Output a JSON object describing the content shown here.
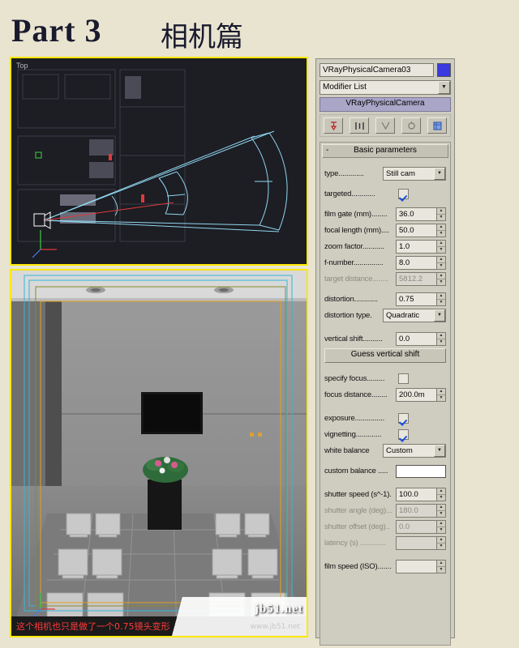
{
  "title": {
    "part": "Part 3",
    "chinese": "相机篇"
  },
  "viewport_top": {
    "label": "Top"
  },
  "viewport_bottom": {
    "caption": "这个相机也只是做了一个0.75镜头变形"
  },
  "panel": {
    "object_name": "VRayPhysicalCamera03",
    "object_color": "#3a3ae0",
    "modifier_list": "Modifier List",
    "modifier_stack_entry": "VRayPhysicalCamera",
    "stack_tools": [
      {
        "name": "pin-stack-icon"
      },
      {
        "name": "show-end-result-icon"
      },
      {
        "name": "make-unique-icon"
      },
      {
        "name": "remove-modifier-icon"
      },
      {
        "name": "configure-sets-icon"
      }
    ],
    "rollout": {
      "title": "Basic parameters",
      "collapse_sign": "-",
      "rows": [
        {
          "label": "type.............",
          "kind": "combo",
          "value": "Still cam"
        },
        {
          "label": "targeted............",
          "kind": "check",
          "value": true
        },
        {
          "label": "film gate (mm)........",
          "kind": "spin",
          "value": "36.0"
        },
        {
          "label": "focal length (mm)....",
          "kind": "spin",
          "value": "50.0"
        },
        {
          "label": "zoom factor...........",
          "kind": "spin",
          "value": "1.0"
        },
        {
          "label": "f-number...............",
          "kind": "spin",
          "value": "8.0"
        },
        {
          "label": "target distance........",
          "kind": "spin",
          "value": "5812.2",
          "disabled": true
        },
        {
          "label": "distortion............",
          "kind": "spin",
          "value": "0.75"
        },
        {
          "label": "distortion type.",
          "kind": "combo",
          "value": "Quadratic"
        },
        {
          "label": "vertical shift..........",
          "kind": "spin",
          "value": "0.0"
        },
        {
          "label": "Guess vertical shift",
          "kind": "button"
        },
        {
          "label": "specify focus.........",
          "kind": "check",
          "value": false
        },
        {
          "label": "focus distance........",
          "kind": "spin",
          "value": "200.0m"
        },
        {
          "label": "exposure...............",
          "kind": "check",
          "value": true
        },
        {
          "label": "vignetting.............",
          "kind": "check",
          "value": true
        },
        {
          "label": "white balance",
          "kind": "combo",
          "value": "Custom"
        },
        {
          "label": "custom balance .....",
          "kind": "swatch",
          "value": "#ffffff"
        },
        {
          "label": "shutter speed (s^-1).",
          "kind": "spin",
          "value": "100.0"
        },
        {
          "label": "shutter angle (deg)...",
          "kind": "spin",
          "value": "180.0",
          "disabled": true
        },
        {
          "label": "shutter offset (deg)..",
          "kind": "spin",
          "value": "0.0",
          "disabled": true
        },
        {
          "label": "latency (s) .............",
          "kind": "spin",
          "value": "",
          "disabled": true
        },
        {
          "label": "film speed (ISO).......",
          "kind": "spin",
          "value": ""
        }
      ]
    }
  },
  "watermark": {
    "main": "jb51.net",
    "sub": "www.jb51.net"
  }
}
